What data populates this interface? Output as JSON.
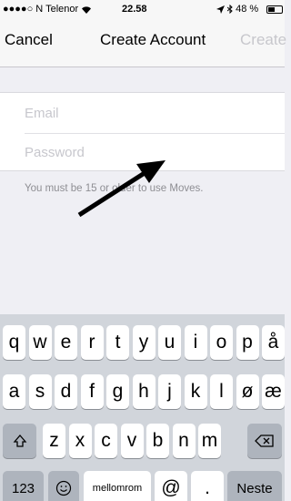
{
  "status_bar": {
    "carrier": "●●●●○ N Telenor",
    "wifi_icon": "wifi-icon",
    "time": "22.58",
    "location_icon": "location-arrow-icon",
    "bluetooth_icon": "bluetooth-icon",
    "battery_percent": "48 %",
    "battery_level": 0.48
  },
  "nav": {
    "cancel_label": "Cancel",
    "title": "Create Account",
    "create_label": "Create"
  },
  "form": {
    "email_placeholder": "Email",
    "password_placeholder": "Password"
  },
  "notice": "You must be 15 or older to use Moves.",
  "keyboard": {
    "row1": [
      "q",
      "w",
      "e",
      "r",
      "t",
      "y",
      "u",
      "i",
      "o",
      "p",
      "å"
    ],
    "row2": [
      "a",
      "s",
      "d",
      "f",
      "g",
      "h",
      "j",
      "k",
      "l",
      "ø",
      "æ"
    ],
    "row3": [
      "z",
      "x",
      "c",
      "v",
      "b",
      "n",
      "m"
    ],
    "shift_icon": "shift-icon",
    "backspace_icon": "backspace-icon",
    "numbers_label": "123",
    "emoji_icon": "emoji-icon",
    "space_label": "mellomrom",
    "at_label": "@",
    "dot_label": ".",
    "return_label": "Neste"
  },
  "colors": {
    "background": "#efeff4",
    "keyboard": "#d1d5db",
    "disabled_text": "#c7c7cc"
  }
}
